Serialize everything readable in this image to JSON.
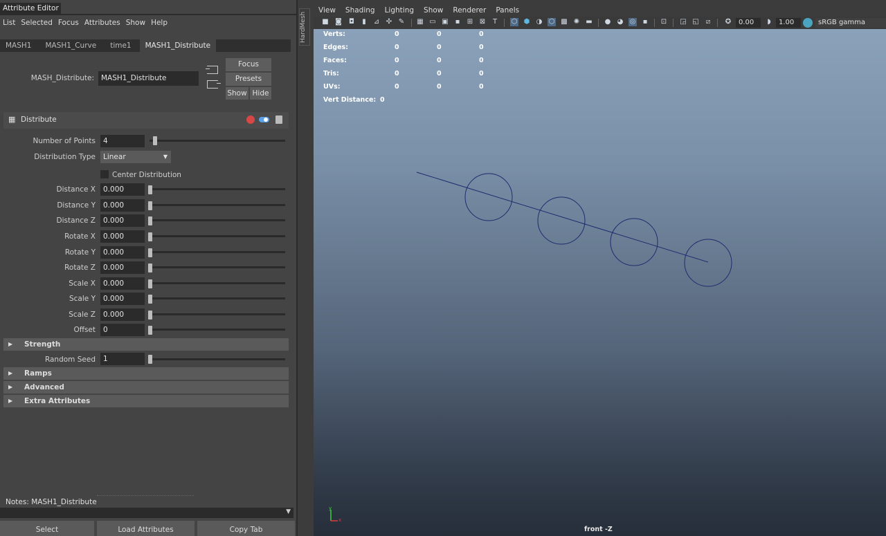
{
  "attribute_editor": {
    "title": "Attribute Editor",
    "menu": [
      "List",
      "Selected",
      "Focus",
      "Attributes",
      "Show",
      "Help"
    ],
    "tabs": [
      "MASH1",
      "MASH1_Curve",
      "time1",
      "MASH1_Distribute"
    ],
    "active_tab": "MASH1_Distribute",
    "node_label": "MASH_Distribute:",
    "node_value": "MASH1_Distribute",
    "focus_label": "Focus",
    "presets_label": "Presets",
    "show_label": "Show",
    "hide_label": "Hide",
    "section_title": "Distribute",
    "number_of_points_label": "Number of Points",
    "number_of_points_value": "4",
    "distribution_type_label": "Distribution Type",
    "distribution_type_value": "Linear",
    "center_distribution_label": "Center Distribution",
    "distance_x_label": "Distance X",
    "distance_x_value": "0.000",
    "distance_y_label": "Distance Y",
    "distance_y_value": "0.000",
    "distance_z_label": "Distance Z",
    "distance_z_value": "0.000",
    "rotate_x_label": "Rotate X",
    "rotate_x_value": "0.000",
    "rotate_y_label": "Rotate Y",
    "rotate_y_value": "0.000",
    "rotate_z_label": "Rotate Z",
    "rotate_z_value": "0.000",
    "scale_x_label": "Scale X",
    "scale_x_value": "0.000",
    "scale_y_label": "Scale Y",
    "scale_y_value": "0.000",
    "scale_z_label": "Scale Z",
    "scale_z_value": "0.000",
    "offset_label": "Offset",
    "offset_value": "0",
    "strength_label": "Strength",
    "random_seed_label": "Random Seed",
    "random_seed_value": "1",
    "ramps_label": "Ramps",
    "advanced_label": "Advanced",
    "extra_attributes_label": "Extra Attributes",
    "notes_label": "Notes:  MASH1_Distribute",
    "select_label": "Select",
    "load_attributes_label": "Load Attributes",
    "copy_tab_label": "Copy Tab"
  },
  "side_tab": "HardMesh",
  "viewport": {
    "menu": [
      "View",
      "Shading",
      "Lighting",
      "Show",
      "Renderer",
      "Panels"
    ],
    "exposure_value": "0.00",
    "gamma_value": "1.00",
    "color_space": "sRGB gamma",
    "hud": {
      "verts_label": "Verts:",
      "edges_label": "Edges:",
      "faces_label": "Faces:",
      "tris_label": "Tris:",
      "uvs_label": "UVs:",
      "vert_distance_label": "Vert Distance:",
      "zero": "0"
    },
    "camera_label": "front -Z",
    "axis_y": "y",
    "axis_x": "x"
  },
  "colors": {
    "panel_bg": "#444444",
    "field_bg": "#2b2b2b",
    "curve_color": "#1f2a6e"
  }
}
